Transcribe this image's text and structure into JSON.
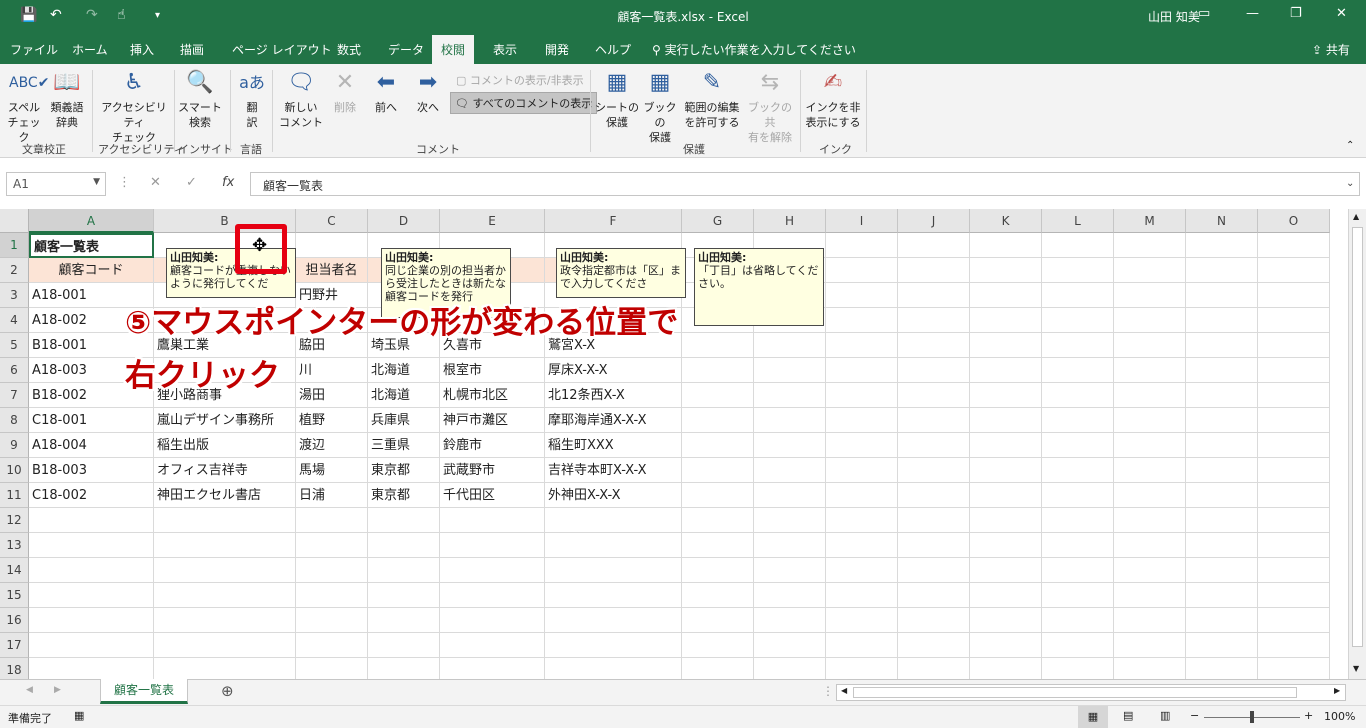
{
  "window": {
    "title": "顧客一覧表.xlsx  -  Excel",
    "user": "山田 知美"
  },
  "tabs": [
    "ファイル",
    "ホーム",
    "挿入",
    "描画",
    "ページ レイアウト",
    "数式",
    "データ",
    "校閲",
    "表示",
    "開発",
    "ヘルプ"
  ],
  "active_tab": "校閲",
  "tell_me": "実行したい作業を入力してください",
  "share": "共有",
  "ribbon": {
    "spelling": "スペル\nチェック",
    "thesaurus": "類義語\n辞典",
    "group_proofing": "文章校正",
    "accessibility": "アクセシビリティ\nチェック",
    "group_accessibility": "アクセシビリティ",
    "smart_lookup": "スマート\n検索",
    "group_insights": "インサイト",
    "translate": "翻\n訳",
    "group_language": "言語",
    "new_comment": "新しい\nコメント",
    "delete": "削除",
    "previous": "前へ",
    "next": "次へ",
    "show_hide_comment": "コメントの表示/非表示",
    "show_all_comments": "すべてのコメントの表示",
    "group_comments": "コメント",
    "protect_sheet": "シートの\n保護",
    "protect_workbook": "ブックの\n保護",
    "allow_edit_ranges": "範囲の編集\nを許可する",
    "unshare_workbook": "ブックの共\n有を解除",
    "group_protect": "保護",
    "hide_ink": "インクを非\n表示にする",
    "group_ink": "インク"
  },
  "formula_bar": {
    "name_box": "A1",
    "formula": "顧客一覧表"
  },
  "columns": [
    "A",
    "B",
    "C",
    "D",
    "E",
    "F",
    "G",
    "H",
    "I",
    "J",
    "K",
    "L",
    "M",
    "N",
    "O"
  ],
  "rows": [
    "1",
    "2",
    "3",
    "4",
    "5",
    "6",
    "7",
    "8",
    "9",
    "10",
    "11",
    "12",
    "13",
    "14",
    "15",
    "16",
    "17",
    "18"
  ],
  "cells": {
    "A1": "顧客一覧表",
    "A2": "顧客コード",
    "C2": "担当者名",
    "A3": "A18-001",
    "C3": "円野井",
    "A4": "A18-002",
    "A5": "B18-001",
    "B5": "鷹巣工業",
    "C5": "脇田",
    "D5": "埼玉県",
    "E5": "久喜市",
    "F5": "鷲宮X-X",
    "A6": "A18-003",
    "C6": "川",
    "D6": "北海道",
    "E6": "根室市",
    "F6": "厚床X-X-X",
    "A7": "B18-002",
    "B7": "狸小路商事",
    "C7": "湯田",
    "D7": "北海道",
    "E7": "札幌市北区",
    "F7": "北12条西X-X",
    "A8": "C18-001",
    "B8": "嵐山デザイン事務所",
    "C8": "植野",
    "D8": "兵庫県",
    "E8": "神戸市灘区",
    "F8": "摩耶海岸通X-X-X",
    "A9": "A18-004",
    "B9": "稲生出版",
    "C9": "渡辺",
    "D9": "三重県",
    "E9": "鈴鹿市",
    "F9": "稲生町XXX",
    "A10": "B18-003",
    "B10": "オフィス吉祥寺",
    "C10": "馬場",
    "D10": "東京都",
    "E10": "武蔵野市",
    "F10": "吉祥寺本町X-X-X",
    "A11": "C18-002",
    "B11": "神田エクセル書店",
    "C11": "日浦",
    "D11": "東京都",
    "E11": "千代田区",
    "F11": "外神田X-X-X"
  },
  "comments": [
    {
      "author": "山田知美:",
      "text": "顧客コードが重複しないように発行してくだ"
    },
    {
      "author": "山田知美:",
      "text": "同じ企業の別の担当者から受注したときは新たな顧客コードを発行"
    },
    {
      "author": "山田知美:",
      "text": "政令指定都市は「区」まで入力してくださ"
    },
    {
      "author": "山田知美:",
      "text": "「丁目」は省略してください。"
    }
  ],
  "annotation": {
    "line1": "⑤マウスポインターの形が変わる位置で",
    "line2": "右クリック"
  },
  "sheet_tab": "顧客一覧表",
  "status": {
    "ready": "準備完了",
    "zoom": "100%"
  },
  "colors": {
    "excel_green": "#217346",
    "annotation_red": "#c00000",
    "note_bg": "#ffffe1"
  }
}
